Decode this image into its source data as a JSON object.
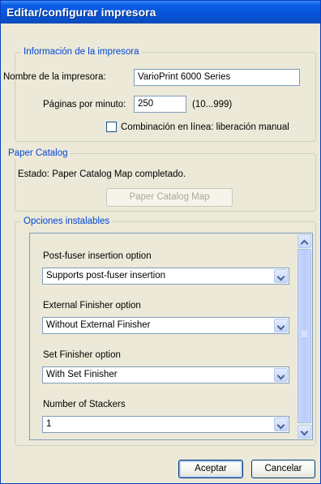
{
  "window": {
    "title": "Editar/configurar impresora"
  },
  "printer_info": {
    "legend": "Información de la impresora",
    "name_label": "Nombre de la impresora:",
    "name_value": "VarioPrint 6000 Series",
    "ppm_label": "Páginas por minuto:",
    "ppm_value": "250",
    "ppm_range": "(10...999)",
    "inline_label": "Combinación en línea: liberación manual",
    "inline_checked": false
  },
  "paper_catalog": {
    "legend": "Paper Catalog",
    "status": "Estado:  Paper Catalog Map completado.",
    "button_label": "Paper Catalog Map"
  },
  "options": {
    "legend": "Opciones instalables",
    "items": [
      {
        "label": "Post-fuser insertion option",
        "value": "Supports post-fuser insertion"
      },
      {
        "label": "External Finisher option",
        "value": "Without External Finisher"
      },
      {
        "label": "Set Finisher option",
        "value": "With Set Finisher"
      },
      {
        "label": "Number of Stackers",
        "value": "1"
      }
    ]
  },
  "buttons": {
    "ok": "Aceptar",
    "cancel": "Cancelar"
  }
}
